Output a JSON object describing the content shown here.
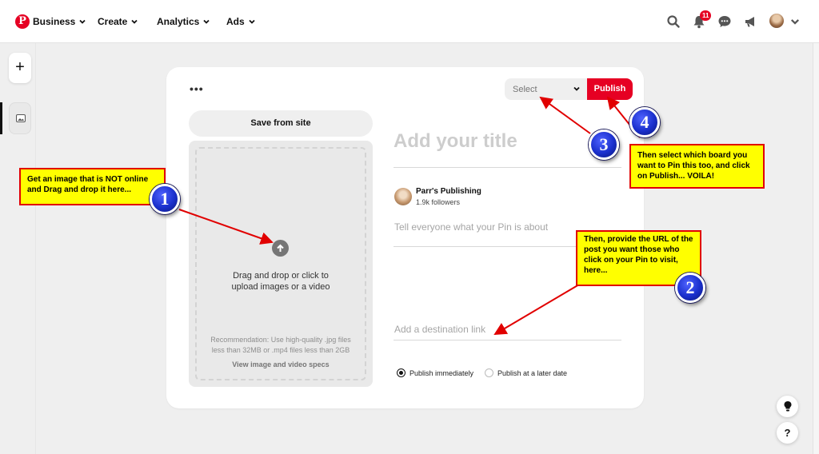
{
  "nav": {
    "logo_letter": "P",
    "items": [
      "Business",
      "Create",
      "Analytics",
      "Ads"
    ],
    "notification_count": "11"
  },
  "rail": {
    "add_label": "+"
  },
  "card": {
    "more_label": "•••",
    "board_select_placeholder": "Select",
    "publish_label": "Publish",
    "save_from_site_label": "Save from site",
    "drop_text_line1": "Drag and drop or click to",
    "drop_text_line2": "upload images or a video",
    "recommendation_line1": "Recommendation: Use high-quality .jpg files",
    "recommendation_line2": "less than 32MB or .mp4 files less than 2GB",
    "specs_link": "View image and video specs",
    "title_placeholder": "Add your title",
    "author_name": "Parr's Publishing",
    "author_followers": "1.9k followers",
    "about_placeholder": "Tell everyone what your Pin is about",
    "link_placeholder": "Add a destination link",
    "publish_options": [
      "Publish immediately",
      "Publish at a later date"
    ],
    "selected_publish_option": "Publish immediately"
  },
  "help": {
    "tips_icon": "lightbulb-icon",
    "help_label": "?"
  },
  "annotations": {
    "note1": "Get an image that is NOT online and Drag and drop it here...",
    "note2": "Then, provide the URL of the post you want those who click on your Pin to visit, here...",
    "note3": "Then select which board you want to Pin this too, and click on Publish... VOILA!",
    "badge1": "1",
    "badge2": "2",
    "badge3": "3",
    "badge4": "4"
  },
  "colors": {
    "brand_red": "#e60023",
    "note_fill": "#ffff00",
    "note_border": "#e10000",
    "badge_blue": "#1a2fcc"
  }
}
